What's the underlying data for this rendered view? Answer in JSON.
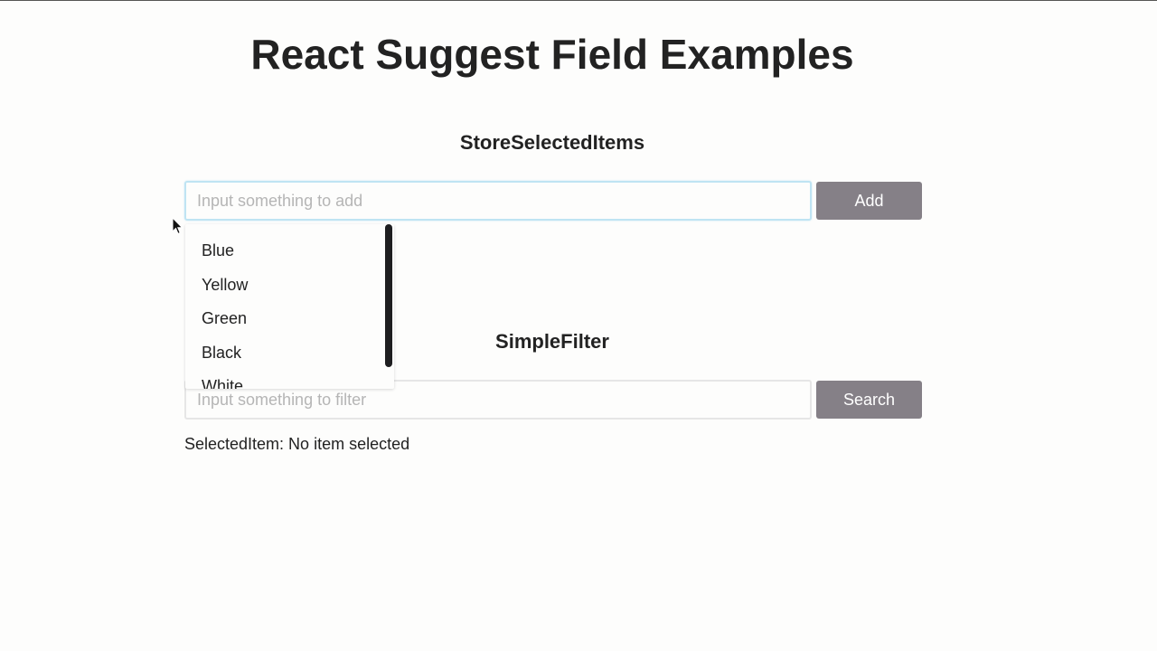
{
  "page": {
    "title": "React Suggest Field Examples"
  },
  "store_selected_items": {
    "heading": "StoreSelectedItems",
    "input_placeholder": "Input something to add",
    "input_value": "",
    "button_label": "Add",
    "suggestions": [
      "Blue",
      "Yellow",
      "Green",
      "Black",
      "White"
    ]
  },
  "simple_filter": {
    "heading": "SimpleFilter",
    "input_placeholder": "Input something to filter",
    "input_value": "",
    "button_label": "Search",
    "selected_label": "SelectedItem: No item selected"
  },
  "colors": {
    "button_bg": "#858087",
    "focus_border": "#bfe4f3",
    "text": "#212121"
  },
  "icons": {
    "cursor": "mouse-pointer-icon"
  }
}
